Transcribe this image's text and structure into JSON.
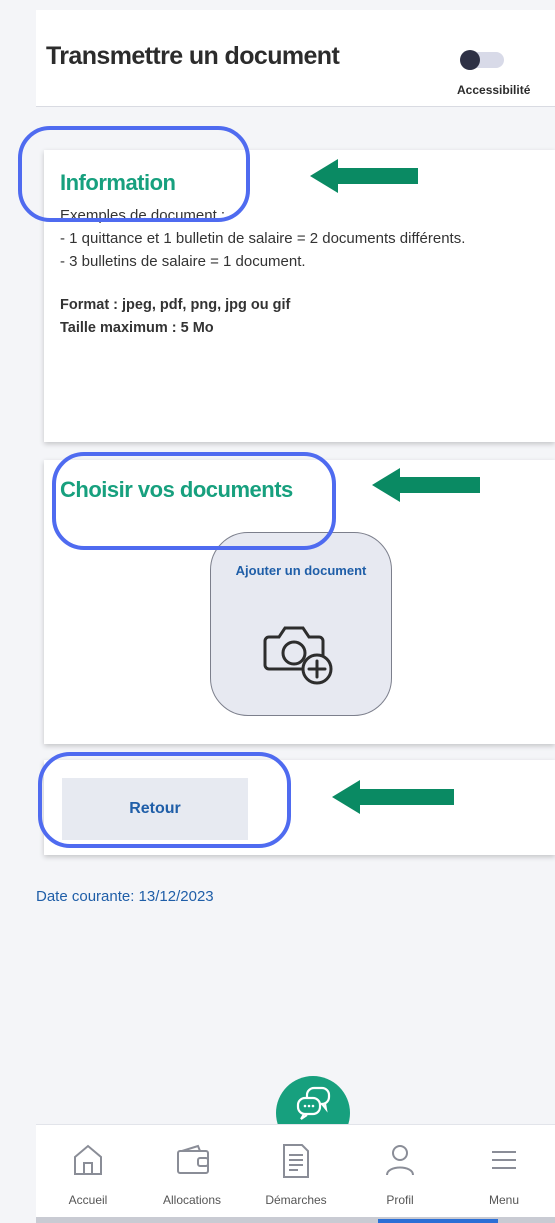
{
  "header": {
    "title": "Transmettre un document",
    "accessibility_label": "Accessibilité"
  },
  "info_card": {
    "title": "Information",
    "lines": [
      "Exemples de document :",
      "- 1 quittance et 1 bulletin de salaire = 2 documents différents.",
      "- 3 bulletins de salaire = 1 document."
    ],
    "format": "Format : jpeg, pdf, png, jpg ou gif",
    "max_size": "Taille maximum : 5 Mo"
  },
  "documents_card": {
    "title": "Choisir vos documents",
    "add_label": "Ajouter un document"
  },
  "back_button": {
    "label": "Retour"
  },
  "date_text": "Date courante: 13/12/2023",
  "bottom_nav": {
    "items": [
      {
        "label": "Accueil",
        "icon": "home-icon"
      },
      {
        "label": "Allocations",
        "icon": "wallet-icon"
      },
      {
        "label": "Démarches",
        "icon": "document-icon"
      },
      {
        "label": "Profil",
        "icon": "profile-icon"
      },
      {
        "label": "Menu",
        "icon": "menu-icon"
      }
    ]
  },
  "colors": {
    "accent_green": "#17a07e",
    "link_blue": "#1f5ea8",
    "annotation_blue": "#4f6bf0",
    "arrow_green": "#0a8a63"
  }
}
